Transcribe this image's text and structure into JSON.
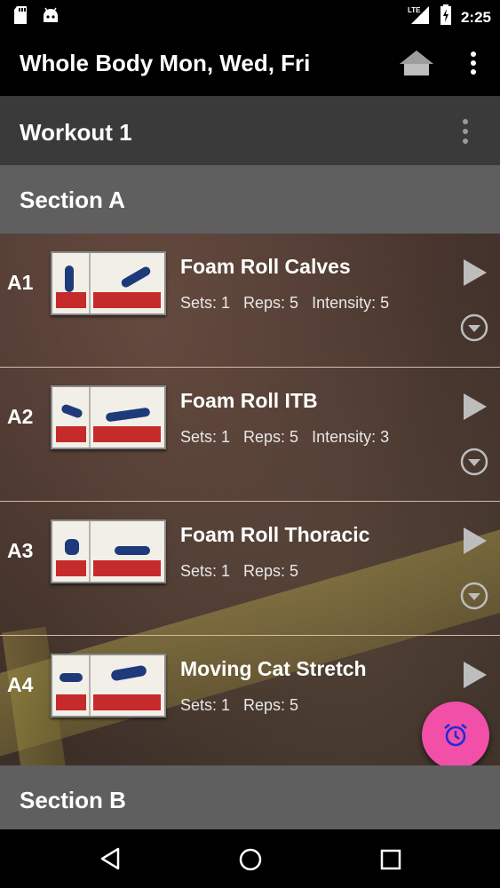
{
  "status_bar": {
    "time": "2:25",
    "network": "LTE",
    "left_icons": [
      "sd-card-icon",
      "android-icon"
    ],
    "right_icons": [
      "lte-signal-icon",
      "battery-charging-icon"
    ]
  },
  "app_bar": {
    "title": "Whole Body Mon, Wed, Fri",
    "actions": [
      "home-icon",
      "overflow-menu-icon"
    ]
  },
  "workout": {
    "title": "Workout 1"
  },
  "sections": [
    {
      "title": "Section A",
      "exercises": [
        {
          "id": "A1",
          "name": "Foam Roll Calves",
          "sets": "Sets: 1",
          "reps": "Reps: 5",
          "intensity": "Intensity: 5"
        },
        {
          "id": "A2",
          "name": "Foam Roll ITB",
          "sets": "Sets: 1",
          "reps": "Reps: 5",
          "intensity": "Intensity: 3"
        },
        {
          "id": "A3",
          "name": "Foam Roll Thoracic",
          "sets": "Sets: 1",
          "reps": "Reps: 5",
          "intensity": ""
        },
        {
          "id": "A4",
          "name": "Moving Cat Stretch",
          "sets": "Sets: 1",
          "reps": "Reps: 5",
          "intensity": ""
        }
      ]
    },
    {
      "title": "Section B"
    }
  ],
  "fab": {
    "icon": "alarm-clock-icon",
    "color": "#f24fa8"
  },
  "colors": {
    "section_header": "#5f5f5f",
    "workout_header": "#3a3a3a",
    "row_divider": "#d8b9a7",
    "fab_icon": "#1f2bd8"
  },
  "nav_bar": [
    "back-icon",
    "home-circle-icon",
    "recents-icon"
  ]
}
